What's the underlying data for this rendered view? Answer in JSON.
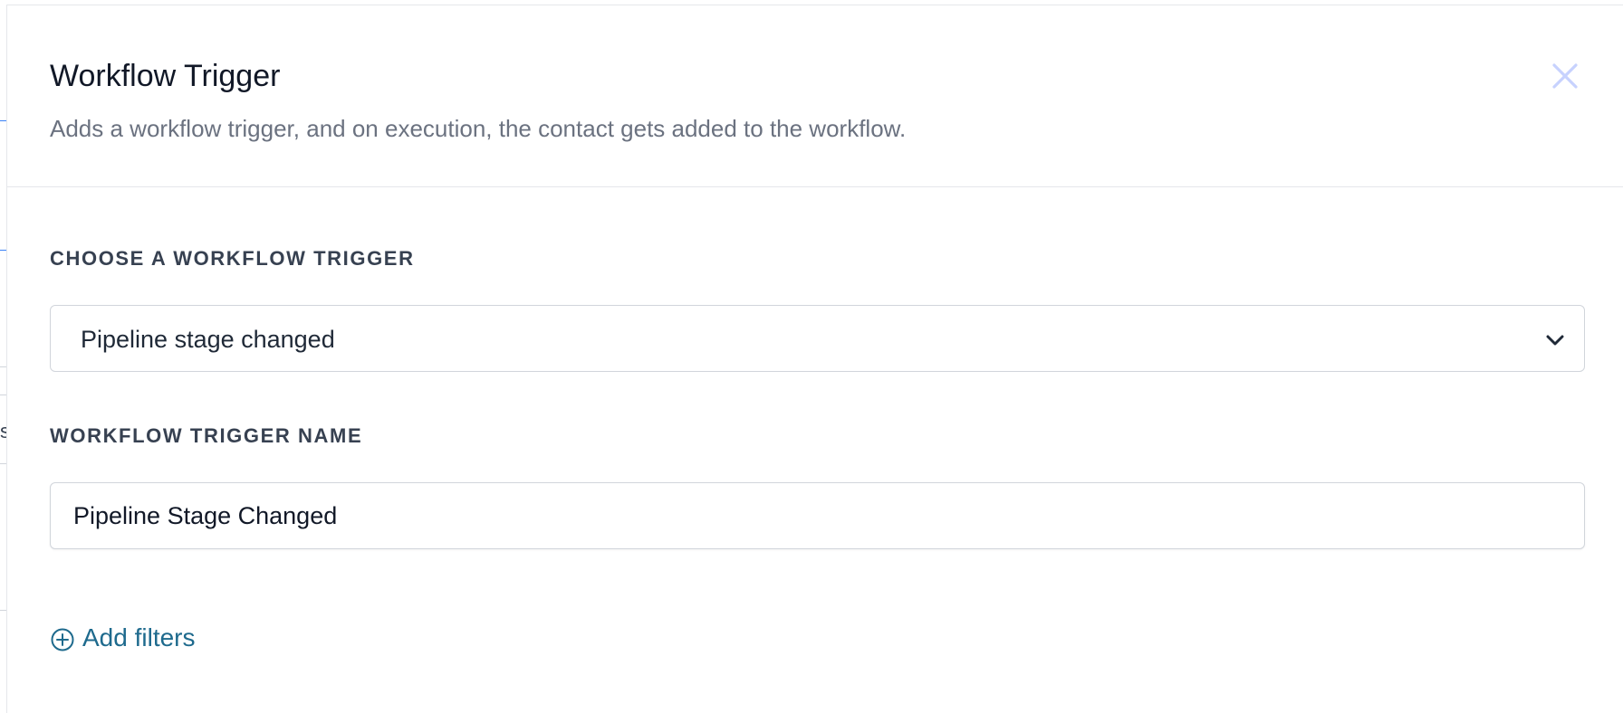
{
  "background": {
    "fragment_text": "s"
  },
  "modal": {
    "title": "Workflow Trigger",
    "subtitle": "Adds a workflow trigger, and on execution, the contact gets added to the workflow.",
    "close_icon": "close-icon"
  },
  "trigger_select": {
    "label": "CHOOSE A WORKFLOW TRIGGER",
    "selected_value": "Pipeline stage changed",
    "icon": "chevron-down-icon"
  },
  "trigger_name": {
    "label": "WORKFLOW TRIGGER NAME",
    "value": "Pipeline Stage Changed"
  },
  "filters": {
    "add_label": "Add filters",
    "icon": "plus-circle-icon"
  },
  "colors": {
    "title": "#111827",
    "subtitle": "#6b7280",
    "label": "#374151",
    "close_icon": "#c7d2fe",
    "link": "#1e6a8d",
    "border": "#d1d5db"
  }
}
